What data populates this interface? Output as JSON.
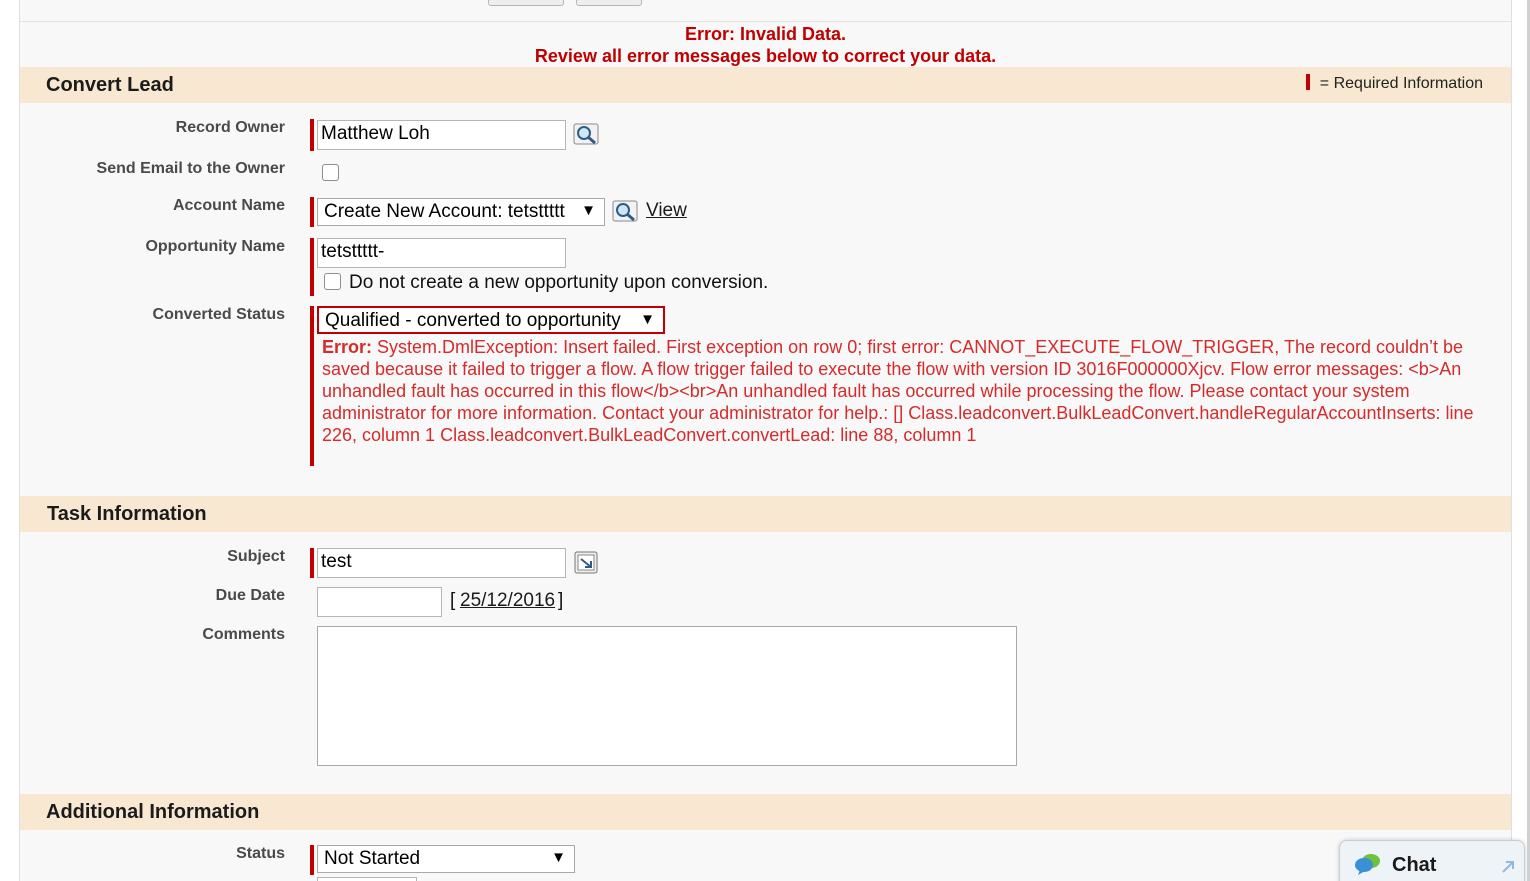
{
  "error_header": {
    "line1": "Error: Invalid Data.",
    "line2": "Review all error messages below to correct your data."
  },
  "convert_lead": {
    "title": "Convert Lead",
    "required_legend": "= Required Information",
    "record_owner_label": "Record Owner",
    "record_owner_value": "Matthew Loh",
    "send_email_label": "Send Email to the Owner",
    "account_name_label": "Account Name",
    "account_name_value": "Create New Account: tetsttttt",
    "view_link": "View",
    "opportunity_name_label": "Opportunity Name",
    "opportunity_name_value": "tetsttttt-",
    "no_opportunity_label": "Do not create a new opportunity upon conversion.",
    "converted_status_label": "Converted Status",
    "converted_status_value": "Qualified - converted to opportunity",
    "error_prefix": "Error:",
    "error_message": "System.DmlException: Insert failed. First exception on row 0; first error: CANNOT_EXECUTE_FLOW_TRIGGER, The record couldn’t be saved because it failed to trigger a flow. A flow trigger failed to execute the flow with version ID 3016F000000Xjcv. Flow error messages: <b>An unhandled fault has occurred in this flow</b><br>An unhandled fault has occurred while processing the flow. Please contact your system administrator for more information. Contact your administrator for help.: [] Class.leadconvert.BulkLeadConvert.handleRegularAccountInserts: line 226, column 1 Class.leadconvert.BulkLeadConvert.convertLead: line 88, column 1"
  },
  "task_information": {
    "title": "Task Information",
    "subject_label": "Subject",
    "subject_value": "test",
    "due_date_label": "Due Date",
    "due_date_value": "",
    "date_bracket_open": "[",
    "date_link": "25/12/2016",
    "date_bracket_close": "]",
    "comments_label": "Comments",
    "comments_value": ""
  },
  "additional_information": {
    "title": "Additional Information",
    "status_label": "Status",
    "status_value": "Not Started"
  },
  "chat": {
    "label": "Chat"
  },
  "colors": {
    "error_red": "#c00000",
    "error_text": "#d62b2b",
    "section_bg": "#f8e8d2",
    "page_bg": "#f8f8f8"
  },
  "icons": {
    "lookup": "magnifier-lookup-icon",
    "combo": "combobox-picker-icon",
    "chat": "chat-bubble-icon",
    "expand": "expand-arrow-icon"
  }
}
